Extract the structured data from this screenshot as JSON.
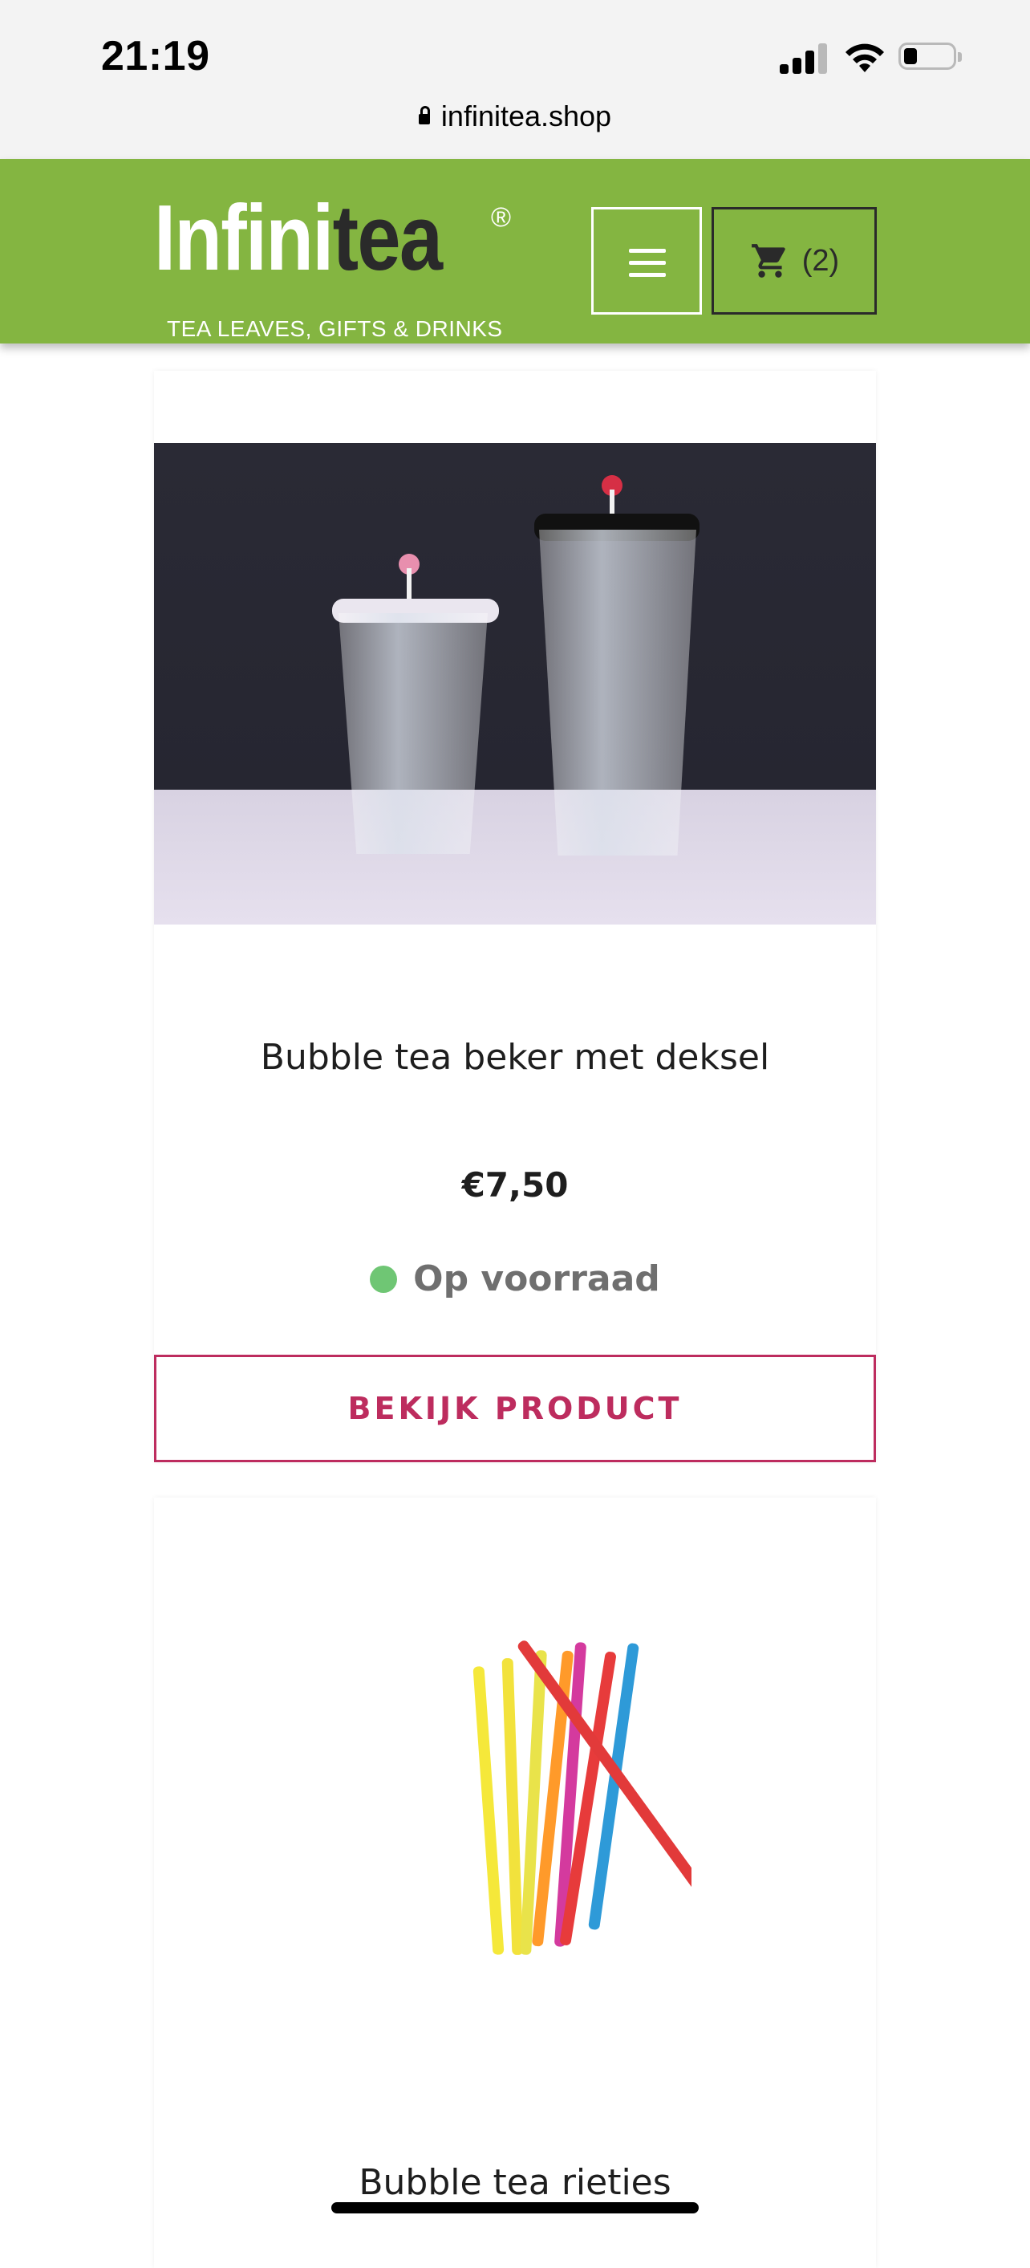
{
  "status_bar": {
    "time": "21:19",
    "url": "infinitea.shop",
    "icons": [
      "cellular-signal-icon",
      "wifi-icon",
      "battery-icon"
    ]
  },
  "header": {
    "logo_light": "Infini",
    "logo_dark": "tea",
    "logo_reg": "®",
    "tagline": "TEA LEAVES, GIFTS & DRINKS",
    "cart_count": "(2)",
    "icons": [
      "hamburger-menu-icon",
      "shopping-cart-icon"
    ],
    "background_color": "#84b541"
  },
  "products": [
    {
      "title": "Bubble tea beker met deksel",
      "price": "€7,50",
      "stock": "Op voorraad",
      "stock_color": "#6fc674",
      "button": "BEKIJK PRODUCT",
      "button_color": "#bd2c5e"
    },
    {
      "title": "Bubble tea rieties"
    }
  ]
}
